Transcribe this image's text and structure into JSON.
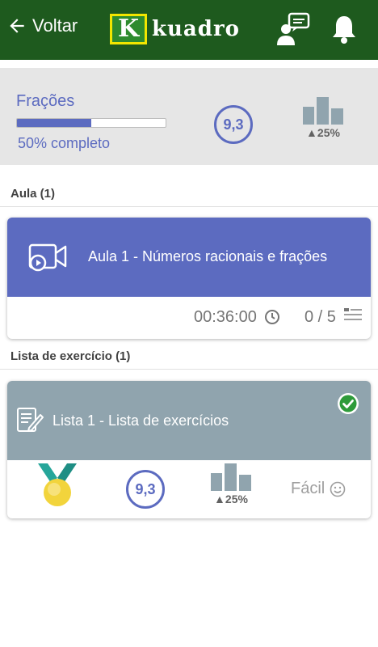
{
  "header": {
    "back_label": "Voltar",
    "logo_letter": "K",
    "logo_text": "kuadro",
    "colors": {
      "bar": "#1e5a1e",
      "logo_border": "#f2e600"
    }
  },
  "summary": {
    "title": "Frações",
    "progress_fraction": 0.5,
    "progress_text": "50% completo",
    "score": "9,3",
    "rank_text": "▲25%",
    "accent_color": "#5c6bc0"
  },
  "sections": {
    "lessons_heading": "Aula (1)",
    "exercises_heading": "Lista de exercício (1)"
  },
  "lesson": {
    "title": "Aula 1 - Números racionais e frações",
    "duration": "00:36:00",
    "count": "0 / 5",
    "icon": "video-camera-icon"
  },
  "exercise": {
    "title": "Lista 1 - Lista de exercícios",
    "score": "9,3",
    "rank_text": "▲25%",
    "difficulty": "Fácil",
    "completed": true,
    "icons": [
      "document-edit-icon",
      "check-circle-icon",
      "medal-icon",
      "smiley-icon"
    ]
  }
}
